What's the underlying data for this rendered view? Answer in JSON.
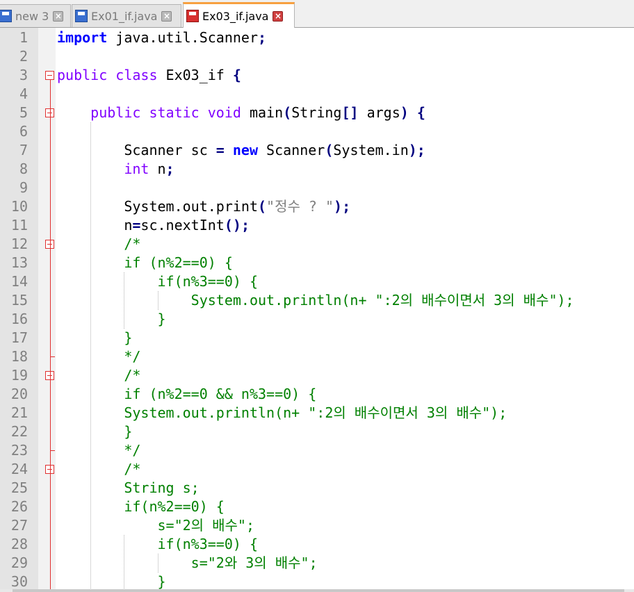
{
  "tabs": [
    {
      "label": "new 3",
      "icon": "blue-save-icon",
      "active": false
    },
    {
      "label": "Ex01_if.java",
      "icon": "blue-save-icon",
      "active": false
    },
    {
      "label": "Ex03_if.java",
      "icon": "red-save-icon",
      "active": true
    }
  ],
  "close_glyph": "×",
  "lines": [
    {
      "n": "1",
      "t": "import java.util.Scanner;"
    },
    {
      "n": "2",
      "t": ""
    },
    {
      "n": "3",
      "t": "public class Ex03_if {"
    },
    {
      "n": "4",
      "t": ""
    },
    {
      "n": "5",
      "t": "    public static void main(String[] args) {"
    },
    {
      "n": "6",
      "t": ""
    },
    {
      "n": "7",
      "t": "        Scanner sc = new Scanner(System.in);"
    },
    {
      "n": "8",
      "t": "        int n;"
    },
    {
      "n": "9",
      "t": ""
    },
    {
      "n": "10",
      "t": "        System.out.print(\"정수 ? \");"
    },
    {
      "n": "11",
      "t": "        n=sc.nextInt();"
    },
    {
      "n": "12",
      "t": "        /*"
    },
    {
      "n": "13",
      "t": "        if (n%2==0) {"
    },
    {
      "n": "14",
      "t": "            if(n%3==0) {"
    },
    {
      "n": "15",
      "t": "                System.out.println(n+ \":2의 배수이면서 3의 배수\");"
    },
    {
      "n": "16",
      "t": "            }"
    },
    {
      "n": "17",
      "t": "        }"
    },
    {
      "n": "18",
      "t": "        */"
    },
    {
      "n": "19",
      "t": "        /*"
    },
    {
      "n": "20",
      "t": "        if (n%2==0 && n%3==0) {"
    },
    {
      "n": "21",
      "t": "        System.out.println(n+ \":2의 배수이면서 3의 배수\");"
    },
    {
      "n": "22",
      "t": "        }"
    },
    {
      "n": "23",
      "t": "        */"
    },
    {
      "n": "24",
      "t": "        /*"
    },
    {
      "n": "25",
      "t": "        String s;"
    },
    {
      "n": "26",
      "t": "        if(n%2==0) {"
    },
    {
      "n": "27",
      "t": "            s=\"2의 배수\";"
    },
    {
      "n": "28",
      "t": "            if(n%3==0) {"
    },
    {
      "n": "29",
      "t": "                s=\"2와 3의 배수\";"
    },
    {
      "n": "30",
      "t": "            }"
    }
  ],
  "colors": {
    "keyword": "#0000ff",
    "type": "#8000ff",
    "operator": "#000080",
    "string": "#808080",
    "comment": "#008000",
    "fold_marker": "#e03030",
    "active_tab_accent": "#f7a040"
  }
}
